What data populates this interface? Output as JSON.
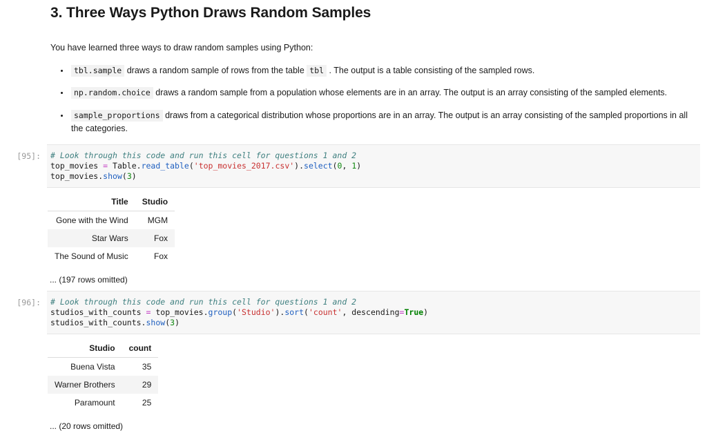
{
  "markdown": {
    "title": "3. Three Ways Python Draws Random Samples",
    "intro": "You have learned three ways to draw random samples using Python:",
    "bullets": [
      {
        "code1": "tbl.sample",
        "text1": " draws a random sample of rows from the table ",
        "code2": "tbl",
        "text2": " . The output is a table consisting of the sampled rows."
      },
      {
        "code1": "np.random.choice",
        "text1": " draws a random sample from a population whose elements are in an array. The output is an array consisting of the sampled elements."
      },
      {
        "code1": "sample_proportions",
        "text1": " draws from a categorical distribution whose proportions are in an array. The output is an array consisting of the sampled proportions in all the categories."
      }
    ]
  },
  "cells": [
    {
      "prompt": "[95]:",
      "code": {
        "comment": "# Look through this code and run this cell for questions 1 and 2",
        "line2_var": "top_movies ",
        "line2_eq": "=",
        "line2_a": " Table.",
        "line2_fn": "read_table",
        "line2_b": "(",
        "line2_str": "'top_movies_2017.csv'",
        "line2_c": ").",
        "line2_fn2": "select",
        "line2_d": "(",
        "line2_num1": "0",
        "line2_e": ", ",
        "line2_num2": "1",
        "line2_f": ")",
        "line3_var": "top_movies.",
        "line3_fn": "show",
        "line3_a": "(",
        "line3_num": "3",
        "line3_b": ")"
      },
      "output": {
        "headers": [
          "Title",
          "Studio"
        ],
        "rows": [
          [
            "Gone with the Wind",
            "MGM"
          ],
          [
            "Star Wars",
            "Fox"
          ],
          [
            "The Sound of Music",
            "Fox"
          ]
        ],
        "omitted": "... (197 rows omitted)"
      }
    },
    {
      "prompt": "[96]:",
      "code": {
        "comment": "# Look through this code and run this cell for questions 1 and 2",
        "line2_var": "studios_with_counts ",
        "line2_eq": "=",
        "line2_a": " top_movies.",
        "line2_fn": "group",
        "line2_b": "(",
        "line2_str": "'Studio'",
        "line2_c": ").",
        "line2_fn2": "sort",
        "line2_d": "(",
        "line2_str2": "'count'",
        "line2_e": ", descending",
        "line2_eq2": "=",
        "line2_kw": "True",
        "line2_f": ")",
        "line3_var": "studios_with_counts.",
        "line3_fn": "show",
        "line3_a": "(",
        "line3_num": "3",
        "line3_b": ")"
      },
      "output": {
        "headers": [
          "Studio",
          "count"
        ],
        "rows": [
          [
            "Buena Vista",
            "35"
          ],
          [
            "Warner Brothers",
            "29"
          ],
          [
            "Paramount",
            "25"
          ]
        ],
        "omitted": "... (20 rows omitted)"
      }
    }
  ],
  "colors": {
    "comment": "#408080",
    "operator": "#c33ac3",
    "function": "#2060c0",
    "string": "#c83030",
    "number": "#118811",
    "keyword": "#008000",
    "code_background": "#f7f7f7",
    "stripe": "#f4f4f4"
  }
}
